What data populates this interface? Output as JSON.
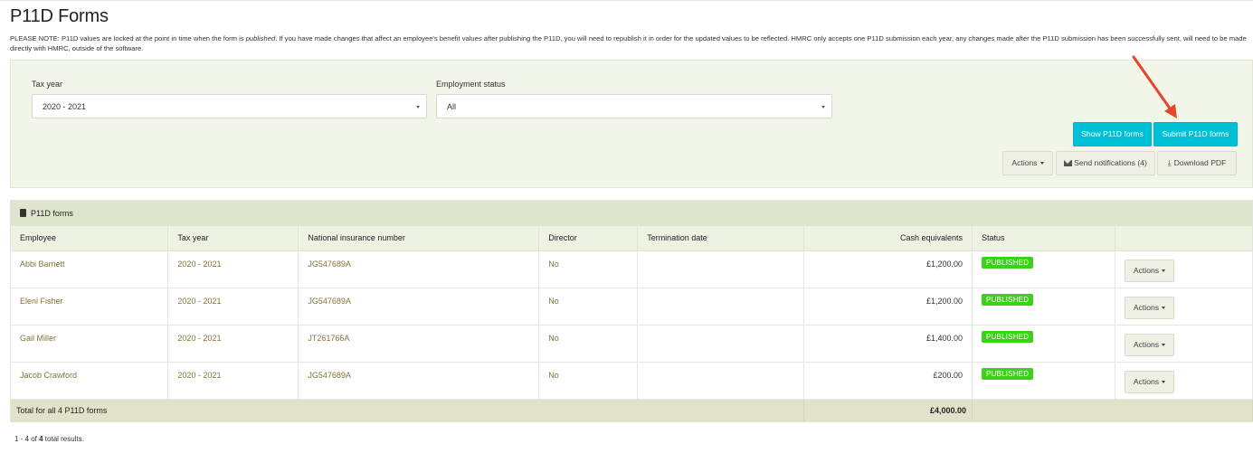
{
  "page": {
    "title": "P11D Forms",
    "note_prefix": "PLEASE NOTE: P11D values are locked at the point in time when the form is ",
    "note_em": "published",
    "note_suffix": ". If you have made changes that affect an employee's benefit values after publishing the P11D, you will need to republish it in order for the updated values to be reflected. HMRC only accepts one P11D submission each year, any changes made after the P11D submission has been successfully sent, will need to be made directly with HMRC, outside of the software."
  },
  "filters": {
    "tax_year_label": "Tax year",
    "tax_year_value": "2020 - 2021",
    "employment_status_label": "Employment status",
    "employment_status_value": "All"
  },
  "buttons": {
    "show": "Show P11D forms",
    "submit": "Submit P11D forms",
    "actions": "Actions",
    "send_notifications": "Send notifications (4)",
    "download_pdf": "Download PDF"
  },
  "table": {
    "panel_title": "P11D forms",
    "headers": {
      "employee": "Employee",
      "tax_year": "Tax year",
      "ni": "National insurance number",
      "director": "Director",
      "termination": "Termination date",
      "cash": "Cash equivalents",
      "status": "Status"
    },
    "rows": [
      {
        "employee": "Abbi Barnett",
        "tax_year": "2020 - 2021",
        "ni": "JG547689A",
        "director": "No",
        "termination": "",
        "cash": "£1,200.00",
        "status": "PUBLISHED",
        "actions": "Actions"
      },
      {
        "employee": "Eleni Fisher",
        "tax_year": "2020 - 2021",
        "ni": "JG547689A",
        "director": "No",
        "termination": "",
        "cash": "£1,200.00",
        "status": "PUBLISHED",
        "actions": "Actions"
      },
      {
        "employee": "Gail Miller",
        "tax_year": "2020 - 2021",
        "ni": "JT261766A",
        "director": "No",
        "termination": "",
        "cash": "£1,400.00",
        "status": "PUBLISHED",
        "actions": "Actions"
      },
      {
        "employee": "Jacob Crawford",
        "tax_year": "2020 - 2021",
        "ni": "JG547689A",
        "director": "No",
        "termination": "",
        "cash": "£200.00",
        "status": "PUBLISHED",
        "actions": "Actions"
      }
    ],
    "total_label": "Total for all 4 P11D forms",
    "total_value": "£4,000.00"
  },
  "results": {
    "prefix": "1 - 4 of ",
    "count": "4",
    "suffix": " total results."
  },
  "colors": {
    "accent": "#00c0d6",
    "published": "#3bd116",
    "link": "#807537",
    "annotation_arrow": "#e8432c"
  },
  "icons": [
    "envelope-icon",
    "download-icon",
    "document-icon",
    "caret-down-icon",
    "annotation-arrow"
  ]
}
